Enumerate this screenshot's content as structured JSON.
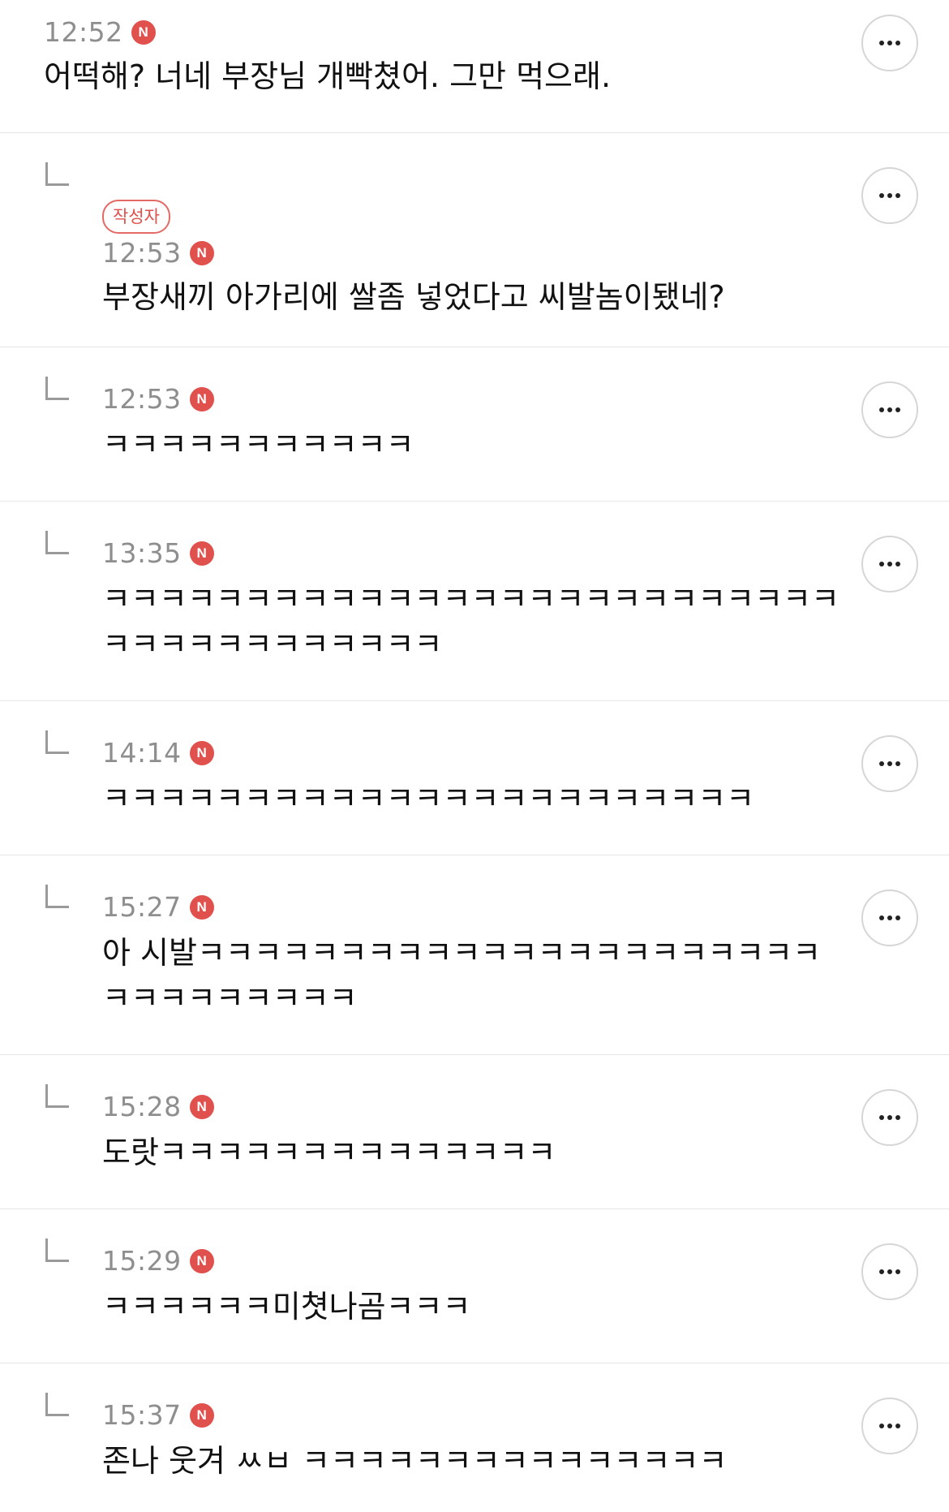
{
  "comments": [
    {
      "time": "12:52",
      "badge": "N",
      "text": "어떡해? 너네 부장님 개빡쳤어. 그만 먹으래.",
      "is_reply": false
    },
    {
      "time": "12:53",
      "badge": "N",
      "author_tag": "작성자",
      "text": "부장새끼 아가리에 쌀좀 넣었다고 씨발놈이됐네?",
      "is_reply": true
    },
    {
      "time": "12:53",
      "badge": "N",
      "text": "ㅋㅋㅋㅋㅋㅋㅋㅋㅋㅋㅋ",
      "is_reply": true
    },
    {
      "time": "13:35",
      "badge": "N",
      "text": "ㅋㅋㅋㅋㅋㅋㅋㅋㅋㅋㅋㅋㅋㅋㅋㅋㅋㅋㅋㅋㅋㅋㅋㅋㅋㅋㅋㅋㅋㅋㅋㅋㅋㅋㅋㅋㅋㅋ",
      "is_reply": true
    },
    {
      "time": "14:14",
      "badge": "N",
      "text": "ㅋㅋㅋㅋㅋㅋㅋㅋㅋㅋㅋㅋㅋㅋㅋㅋㅋㅋㅋㅋㅋㅋㅋ",
      "is_reply": true
    },
    {
      "time": "15:27",
      "badge": "N",
      "text": "아 시발ㅋㅋㅋㅋㅋㅋㅋㅋㅋㅋㅋㅋㅋㅋㅋㅋㅋㅋㅋㅋㅋㅋㅋㅋㅋㅋㅋㅋㅋㅋㅋ",
      "is_reply": true
    },
    {
      "time": "15:28",
      "badge": "N",
      "text": "도랏ㅋㅋㅋㅋㅋㅋㅋㅋㅋㅋㅋㅋㅋㅋ",
      "is_reply": true
    },
    {
      "time": "15:29",
      "badge": "N",
      "text": "ㅋㅋㅋㅋㅋㅋ미쳣나곰ㅋㅋㅋ",
      "is_reply": true
    },
    {
      "time": "15:37",
      "badge": "N",
      "text": "존나 웃겨 ㅆㅂ ㅋㅋㅋㅋㅋㅋㅋㅋㅋㅋㅋㅋㅋㅋㅋ",
      "is_reply": true
    }
  ],
  "icons": {
    "reply": "reply-arrow-icon",
    "more": "more-options-icon",
    "new": "new-badge-icon"
  },
  "colors": {
    "badge": "#e0504c",
    "time": "#8e8e8e",
    "divider": "#e6e6e6"
  }
}
